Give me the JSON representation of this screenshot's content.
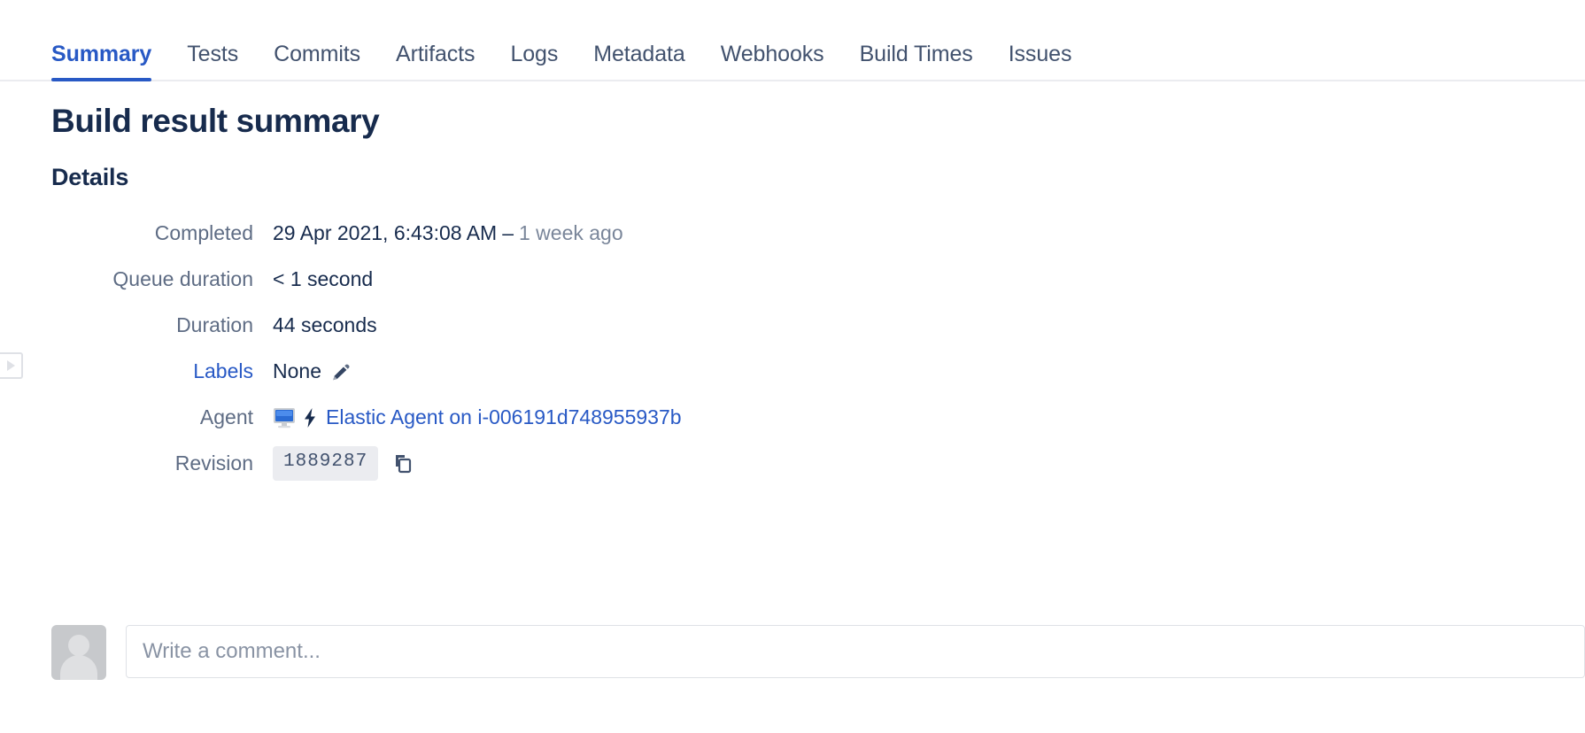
{
  "sidebar": {
    "expand_handle_icon": "triangle-right-icon"
  },
  "tabs": [
    {
      "label": "Summary",
      "active": true
    },
    {
      "label": "Tests",
      "active": false
    },
    {
      "label": "Commits",
      "active": false
    },
    {
      "label": "Artifacts",
      "active": false
    },
    {
      "label": "Logs",
      "active": false
    },
    {
      "label": "Metadata",
      "active": false
    },
    {
      "label": "Webhooks",
      "active": false
    },
    {
      "label": "Build Times",
      "active": false
    },
    {
      "label": "Issues",
      "active": false
    }
  ],
  "page": {
    "title": "Build result summary",
    "section_title": "Details"
  },
  "details": {
    "completed": {
      "label": "Completed",
      "value": "29 Apr 2021, 6:43:08 AM",
      "separator": "–",
      "relative": "1 week ago"
    },
    "queue_duration": {
      "label": "Queue duration",
      "value": "< 1 second"
    },
    "duration": {
      "label": "Duration",
      "value": "44 seconds"
    },
    "labels": {
      "label": "Labels",
      "value": "None",
      "edit_icon": "pencil-icon"
    },
    "agent": {
      "label": "Agent",
      "monitor_icon": "monitor-icon",
      "bolt_icon": "lightning-bolt-icon",
      "value": "Elastic Agent on i-006191d748955937b"
    },
    "revision": {
      "label": "Revision",
      "value": "1889287",
      "copy_icon": "copy-icon"
    }
  },
  "comment": {
    "avatar_icon": "user-avatar",
    "placeholder": "Write a comment...",
    "value": ""
  },
  "colors": {
    "accent": "#2859C5",
    "text": "#172B4D",
    "muted": "#5E6C84",
    "border": "#DFE1E6",
    "chip_bg": "#EBECF0"
  }
}
